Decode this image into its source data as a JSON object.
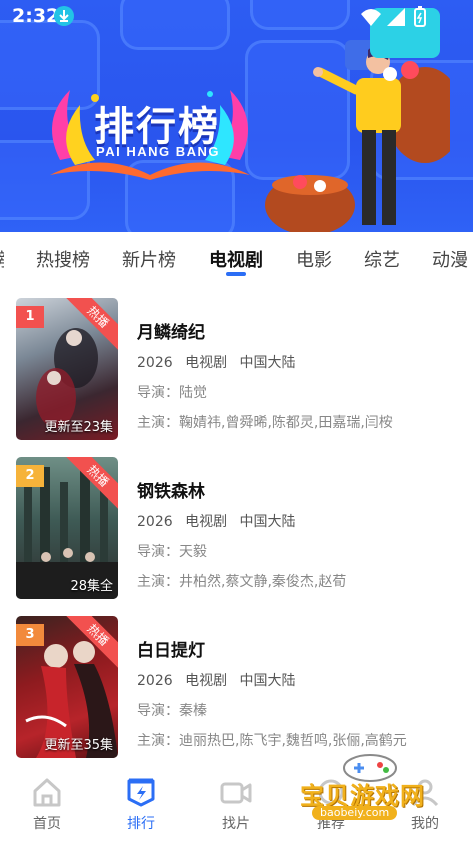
{
  "status_bar": {
    "time": "2:32"
  },
  "banner": {
    "title": "排行榜",
    "subtitle": "PAI HANG BANG"
  },
  "tabs": [
    {
      "label": "热搜榜"
    },
    {
      "label": "新片榜"
    },
    {
      "label": "电视剧",
      "active": true
    },
    {
      "label": "电影"
    },
    {
      "label": "综艺"
    },
    {
      "label": "动漫"
    }
  ],
  "items": [
    {
      "rank": "1",
      "badge": "热播",
      "episode": "更新至23集",
      "title": "月鳞绮纪",
      "year": "2026",
      "category": "电视剧",
      "region": "中国大陆",
      "director": "导演：陆觉",
      "actors": "主演：鞠婧祎,曾舜晞,陈都灵,田嘉瑞,闫桉",
      "rank_color": "#f2514f"
    },
    {
      "rank": "2",
      "badge": "热播",
      "episode": "28集全",
      "title": "钢铁森林",
      "year": "2026",
      "category": "电视剧",
      "region": "中国大陆",
      "director": "导演：天毅",
      "actors": "主演：井柏然,蔡文静,秦俊杰,赵荀",
      "rank_color": "#f6b33a"
    },
    {
      "rank": "3",
      "badge": "热播",
      "episode": "更新至35集",
      "title": "白日提灯",
      "year": "2026",
      "category": "电视剧",
      "region": "中国大陆",
      "director": "导演：秦榛",
      "actors": "主演：迪丽热巴,陈飞宇,魏哲鸣,张俪,高鹤元",
      "rank_color": "#f28a3c"
    }
  ],
  "bottom_nav": [
    {
      "label": "首页",
      "icon": "home-icon"
    },
    {
      "label": "排行",
      "icon": "ranking-icon",
      "active": true
    },
    {
      "label": "找片",
      "icon": "video-camera-icon"
    },
    {
      "label": "推荐",
      "icon": "recommend-icon"
    },
    {
      "label": "我的",
      "icon": "profile-icon"
    }
  ],
  "watermark": {
    "text": "宝贝游戏网",
    "url": "baobeiy.com"
  },
  "colors": {
    "accent": "#2b6ef5",
    "banner": "#2d5df3",
    "hot": "#f2514f"
  }
}
